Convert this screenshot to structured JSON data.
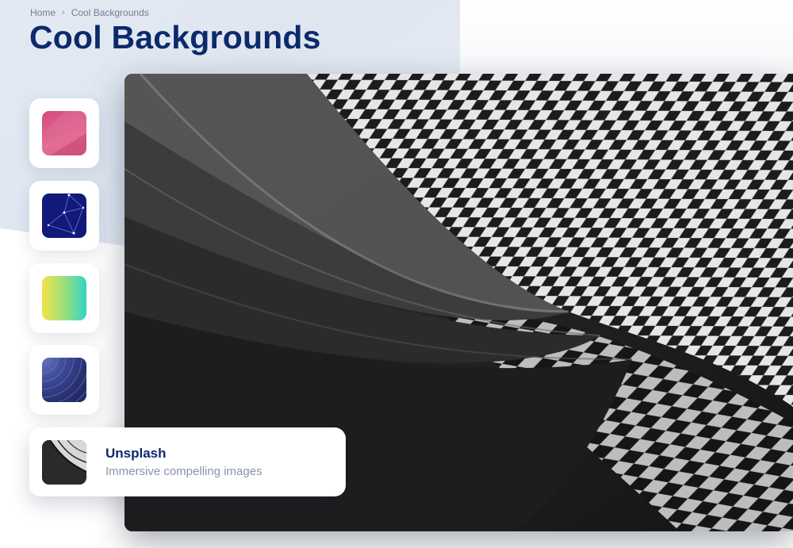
{
  "breadcrumb": {
    "home": "Home",
    "separator": "›",
    "current": "Cool Backgrounds"
  },
  "page": {
    "title": "Cool Backgrounds"
  },
  "colors": {
    "title": "#0c2a6b",
    "pink_thumb": "#d24a7c",
    "network_thumb": "#13197a",
    "gradient_thumb_start": "#f3e24a",
    "gradient_thumb_end": "#33d3c6",
    "waves_thumb": "#28306f"
  },
  "options": [
    {
      "name": "pink-low-poly",
      "selected": false
    },
    {
      "name": "constellation-network",
      "selected": false
    },
    {
      "name": "yellow-teal-gradient",
      "selected": false
    },
    {
      "name": "layered-waves",
      "selected": false
    },
    {
      "name": "unsplash",
      "selected": true
    }
  ],
  "unsplash": {
    "title": "Unsplash",
    "subtitle": "Immersive compelling images"
  }
}
